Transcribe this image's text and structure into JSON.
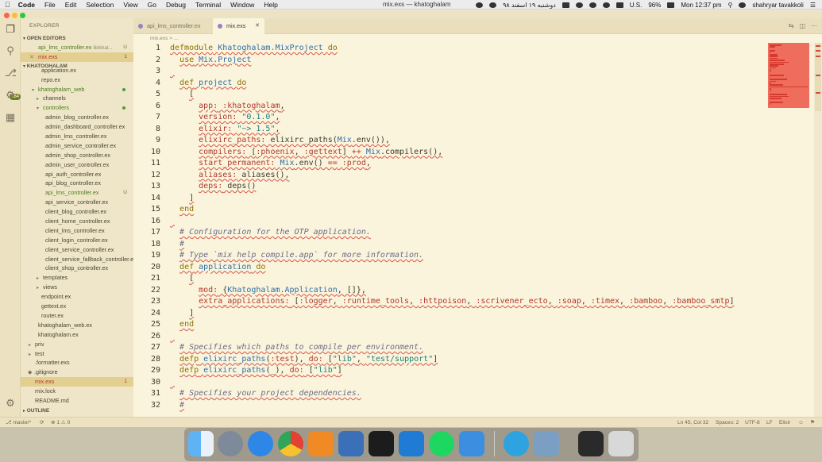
{
  "menubar": {
    "app_name": "Code",
    "menus": [
      "File",
      "Edit",
      "Selection",
      "View",
      "Go",
      "Debug",
      "Terminal",
      "Window",
      "Help"
    ],
    "window_title": "mix.exs — khatoghalam",
    "date_fa": "دوشنبه ۱۹ اسفند ۹۸",
    "input_locale": "U.S.",
    "battery": "96%",
    "clock": "Mon 12:37 pm",
    "user": "shahryar tavakkoli"
  },
  "sidebar": {
    "title": "EXPLORER",
    "open_editors_label": "OPEN EDITORS",
    "open_editors": [
      {
        "name": "api_lms_controller.ex",
        "hint": "lib/khat...",
        "badge": "U"
      },
      {
        "name": "mix.exs",
        "badge": "1"
      }
    ],
    "project_label": "KHATOGHALAM",
    "tree": [
      {
        "name": "application.ex"
      },
      {
        "name": "repo.ex"
      },
      {
        "name": "khatoghalam_web"
      },
      {
        "name": "channels"
      },
      {
        "name": "controllers"
      },
      {
        "name": "admin_blog_controller.ex"
      },
      {
        "name": "admin_dashboard_controller.ex"
      },
      {
        "name": "admin_lms_controller.ex"
      },
      {
        "name": "admin_service_controller.ex"
      },
      {
        "name": "admin_shop_controller.ex"
      },
      {
        "name": "admin_user_controller.ex"
      },
      {
        "name": "api_auth_controller.ex"
      },
      {
        "name": "api_blog_controller.ex"
      },
      {
        "name": "api_lms_controller.ex",
        "badge": "U"
      },
      {
        "name": "api_service_controller.ex"
      },
      {
        "name": "client_blog_controller.ex"
      },
      {
        "name": "client_home_controller.ex"
      },
      {
        "name": "client_lms_controller.ex"
      },
      {
        "name": "client_login_controller.ex"
      },
      {
        "name": "client_service_controller.ex"
      },
      {
        "name": "client_service_fallback_controller.ex"
      },
      {
        "name": "client_shop_controller.ex"
      },
      {
        "name": "templates"
      },
      {
        "name": "views"
      },
      {
        "name": "endpoint.ex"
      },
      {
        "name": "gettext.ex"
      },
      {
        "name": "router.ex"
      },
      {
        "name": "khatoghalam_web.ex"
      },
      {
        "name": "khatoghalam.ex"
      },
      {
        "name": "priv"
      },
      {
        "name": "test"
      },
      {
        "name": ".formatter.exs"
      },
      {
        "name": ".gitignore"
      },
      {
        "name": "mix.exs",
        "badge": "1"
      },
      {
        "name": "mix.lock"
      },
      {
        "name": "README.md"
      }
    ],
    "outline_label": "OUTLINE"
  },
  "tabs": [
    {
      "label": "api_lms_controller.ex"
    },
    {
      "label": "mix.exs"
    }
  ],
  "breadcrumb": "mix.exs > ...",
  "code_lines": [
    "defmodule Khatoghalam.MixProject do",
    "  use Mix.Project",
    "",
    "  def project do",
    "    [",
    "      app: :khatoghalam,",
    "      version: \"0.1.0\",",
    "      elixir: \"~> 1.5\",",
    "      elixirc_paths: elixirc_paths(Mix.env()),",
    "      compilers: [:phoenix, :gettext] ++ Mix.compilers(),",
    "      start_permanent: Mix.env() == :prod,",
    "      aliases: aliases(),",
    "      deps: deps()",
    "    ]",
    "  end",
    "",
    "  # Configuration for the OTP application.",
    "  #",
    "  # Type `mix help compile.app` for more information.",
    "  def application do",
    "    [",
    "      mod: {Khatoghalam.Application, []},",
    "      extra_applications: [:logger, :runtime_tools, :httpoison, :scrivener_ecto, :soap, :timex, :bamboo, :bamboo_smtp]",
    "    ]",
    "  end",
    "",
    "  # Specifies which paths to compile per environment.",
    "  defp elixirc_paths(:test), do: [\"lib\", \"test/support\"]",
    "  defp elixirc_paths(_), do: [\"lib\"]",
    "",
    "  # Specifies your project dependencies.",
    "  #"
  ],
  "statusbar": {
    "branch": "master*",
    "sync": "⟳",
    "problems": "⊗ 1 ⚠ 0",
    "cursor": "Ln 45, Col 32",
    "spaces": "Spaces: 2",
    "encoding": "UTF-8",
    "eol": "LF",
    "language": "Elixir"
  },
  "dock": {
    "apps": [
      "finder-icon",
      "launchpad-icon",
      "safari-icon",
      "chrome-icon",
      "books-icon",
      "network-icon",
      "terminal-icon",
      "vscode-icon",
      "spotify-icon",
      "xcode-icon",
      "telegram-icon",
      "preview-icon",
      "scanner-icon",
      "trash-icon"
    ]
  }
}
